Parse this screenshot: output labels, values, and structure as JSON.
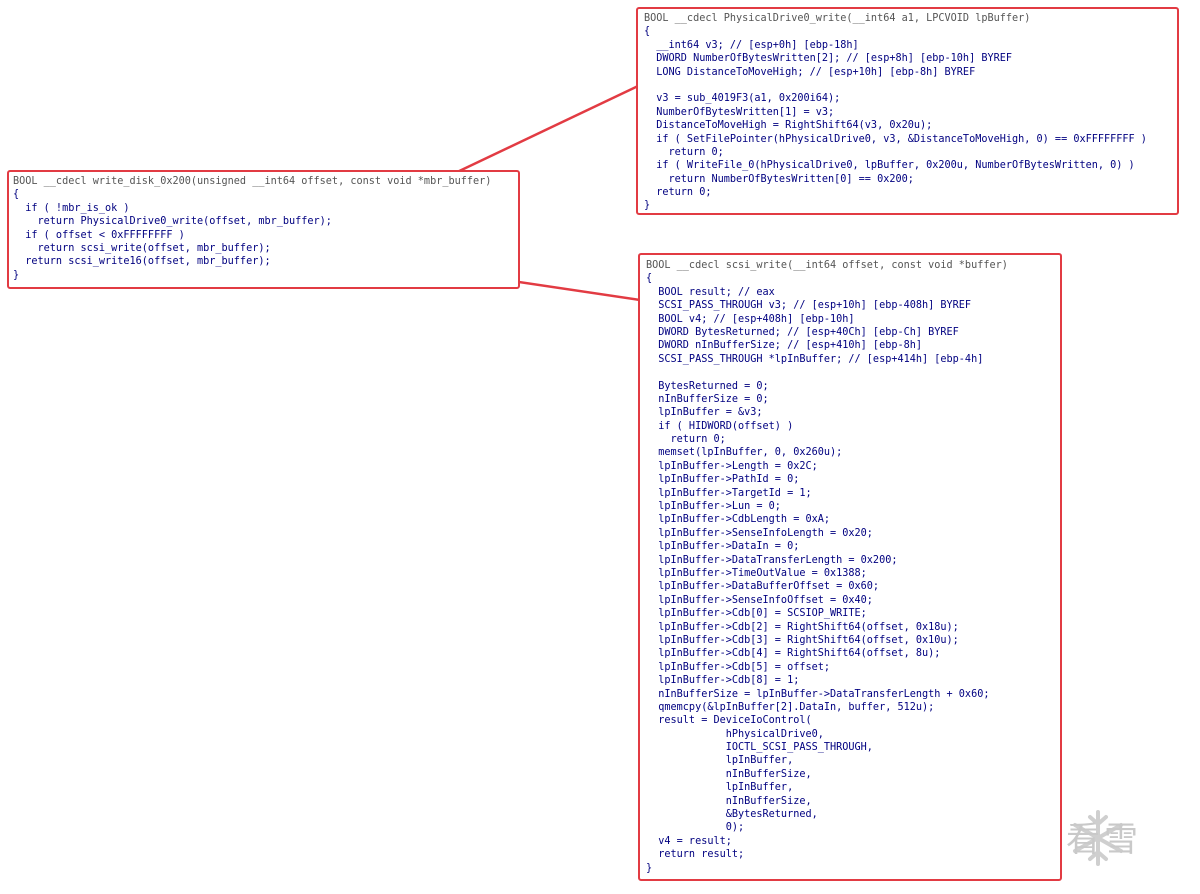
{
  "panels": {
    "write_disk": {
      "lines": [
        "BOOL __cdecl write_disk_0x200(unsigned __int64 offset, const void *mbr_buffer)",
        "{",
        "  if ( !mbr_is_ok )",
        "    return PhysicalDrive0_write(offset, mbr_buffer);",
        "  if ( offset < 0xFFFFFFFF )",
        "    return scsi_write(offset, mbr_buffer);",
        "  return scsi_write16(offset, mbr_buffer);",
        "}"
      ]
    },
    "physical_drive": {
      "lines": [
        "BOOL __cdecl PhysicalDrive0_write(__int64 a1, LPCVOID lpBuffer)",
        "{",
        "  __int64 v3; // [esp+0h] [ebp-18h]",
        "  DWORD NumberOfBytesWritten[2]; // [esp+8h] [ebp-10h] BYREF",
        "  LONG DistanceToMoveHigh; // [esp+10h] [ebp-8h] BYREF",
        "",
        "  v3 = sub_4019F3(a1, 0x200i64);",
        "  NumberOfBytesWritten[1] = v3;",
        "  DistanceToMoveHigh = RightShift64(v3, 0x20u);",
        "  if ( SetFilePointer(hPhysicalDrive0, v3, &DistanceToMoveHigh, 0) == 0xFFFFFFFF )",
        "    return 0;",
        "  if ( WriteFile_0(hPhysicalDrive0, lpBuffer, 0x200u, NumberOfBytesWritten, 0) )",
        "    return NumberOfBytesWritten[0] == 0x200;",
        "  return 0;",
        "}"
      ]
    },
    "scsi_write": {
      "lines": [
        "BOOL __cdecl scsi_write(__int64 offset, const void *buffer)",
        "{",
        "  BOOL result; // eax",
        "  SCSI_PASS_THROUGH v3; // [esp+10h] [ebp-408h] BYREF",
        "  BOOL v4; // [esp+408h] [ebp-10h]",
        "  DWORD BytesReturned; // [esp+40Ch] [ebp-Ch] BYREF",
        "  DWORD nInBufferSize; // [esp+410h] [ebp-8h]",
        "  SCSI_PASS_THROUGH *lpInBuffer; // [esp+414h] [ebp-4h]",
        "",
        "  BytesReturned = 0;",
        "  nInBufferSize = 0;",
        "  lpInBuffer = &v3;",
        "  if ( HIDWORD(offset) )",
        "    return 0;",
        "  memset(lpInBuffer, 0, 0x260u);",
        "  lpInBuffer->Length = 0x2C;",
        "  lpInBuffer->PathId = 0;",
        "  lpInBuffer->TargetId = 1;",
        "  lpInBuffer->Lun = 0;",
        "  lpInBuffer->CdbLength = 0xA;",
        "  lpInBuffer->SenseInfoLength = 0x20;",
        "  lpInBuffer->DataIn = 0;",
        "  lpInBuffer->DataTransferLength = 0x200;",
        "  lpInBuffer->TimeOutValue = 0x1388;",
        "  lpInBuffer->DataBufferOffset = 0x60;",
        "  lpInBuffer->SenseInfoOffset = 0x40;",
        "  lpInBuffer->Cdb[0] = SCSIOP_WRITE;",
        "  lpInBuffer->Cdb[2] = RightShift64(offset, 0x18u);",
        "  lpInBuffer->Cdb[3] = RightShift64(offset, 0x10u);",
        "  lpInBuffer->Cdb[4] = RightShift64(offset, 8u);",
        "  lpInBuffer->Cdb[5] = offset;",
        "  lpInBuffer->Cdb[8] = 1;",
        "  nInBufferSize = lpInBuffer->DataTransferLength + 0x60;",
        "  qmemcpy(&lpInBuffer[2].DataIn, buffer, 512u);",
        "  result = DeviceIoControl(",
        "             hPhysicalDrive0,",
        "             IOCTL_SCSI_PASS_THROUGH,",
        "             lpInBuffer,",
        "             nInBufferSize,",
        "             lpInBuffer,",
        "             nInBufferSize,",
        "             &BytesReturned,",
        "             0);",
        "  v4 = result;",
        "  return result;",
        "}"
      ]
    }
  },
  "colors": {
    "frame": "#e23b43",
    "code": "#000080",
    "variable": "#7f7fe6"
  },
  "watermark": {
    "icon": "snowflake-icon",
    "text": "看雪"
  }
}
